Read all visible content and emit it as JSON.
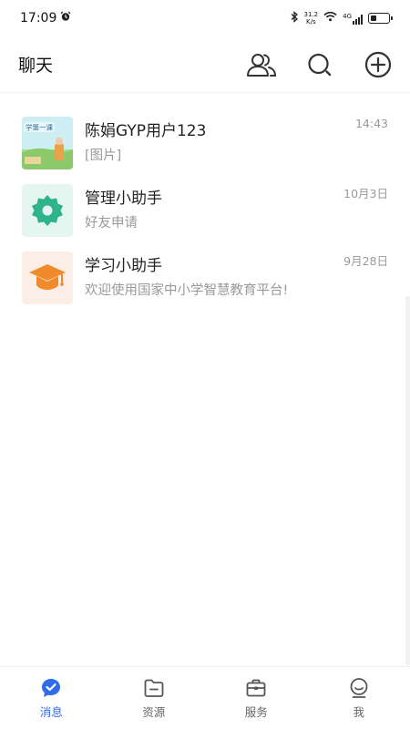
{
  "status_bar": {
    "time": "17:09",
    "net_speed_value": "31.2",
    "net_speed_unit": "K/s",
    "network": "4G",
    "battery_level": 0.35
  },
  "header": {
    "title": "聊天"
  },
  "chats": [
    {
      "name": "陈娟GYP用户123",
      "preview": "[图片]",
      "time": "14:43",
      "avatar_text": "学第一课"
    },
    {
      "name": "管理小助手",
      "preview": "好友申请",
      "time": "10月3日"
    },
    {
      "name": "学习小助手",
      "preview": "欢迎使用国家中小学智慧教育平台!",
      "time": "9月28日"
    }
  ],
  "bottom_nav": [
    {
      "label": "消息",
      "icon": "message-icon",
      "active": true
    },
    {
      "label": "资源",
      "icon": "folder-icon",
      "active": false
    },
    {
      "label": "服务",
      "icon": "briefcase-icon",
      "active": false
    },
    {
      "label": "我",
      "icon": "profile-icon",
      "active": false
    }
  ],
  "colors": {
    "accent": "#2f6ce8",
    "manager_avatar_bg": "#e4f6ef",
    "manager_avatar_fg": "#2fb38a",
    "study_avatar_bg": "#fbeee6",
    "study_avatar_fg": "#f08a2a"
  }
}
